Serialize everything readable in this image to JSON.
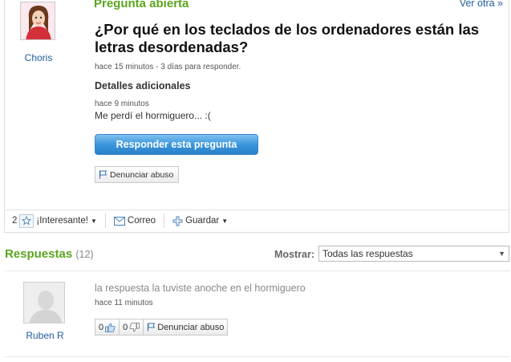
{
  "question": {
    "status": "Pregunta abierta",
    "see_all": "Ver otra »",
    "author": "Choris",
    "title": "¿Por qué en los teclados de los ordenadores están las letras desordenadas?",
    "meta": "hace 15 minutos - 3 días para responder.",
    "details_heading": "Detalles adicionales",
    "details_time": "hace 9 minutos",
    "details_text": "Me perdí el hormiguero... :(",
    "answer_button": "Responder esta pregunta",
    "report_button": "Denunciar abuso"
  },
  "action_bar": {
    "interest_count": "2",
    "interest_label": "¡Interesante!",
    "mail_label": "Correo",
    "save_label": "Guardar"
  },
  "answers": {
    "title": "Respuestas",
    "count": "(12)",
    "show_label": "Mostrar:",
    "show_selected": "Todas las respuestas",
    "items": [
      {
        "author": "Ruben R",
        "text": "la respuesta la tuviste anoche en el hormiguero",
        "time": "hace 11 minutos",
        "thumbs_up": "0",
        "thumbs_down": "0",
        "report": "Denunciar abuso"
      }
    ]
  },
  "colors": {
    "accent_green": "#5aa61e",
    "link_blue": "#1f5c99",
    "button_blue": "#3b97dc"
  },
  "icons": [
    "star-icon",
    "mail-icon",
    "plus-icon",
    "flag-icon",
    "thumbs-up-icon",
    "thumbs-down-icon",
    "chevron-down-icon"
  ]
}
